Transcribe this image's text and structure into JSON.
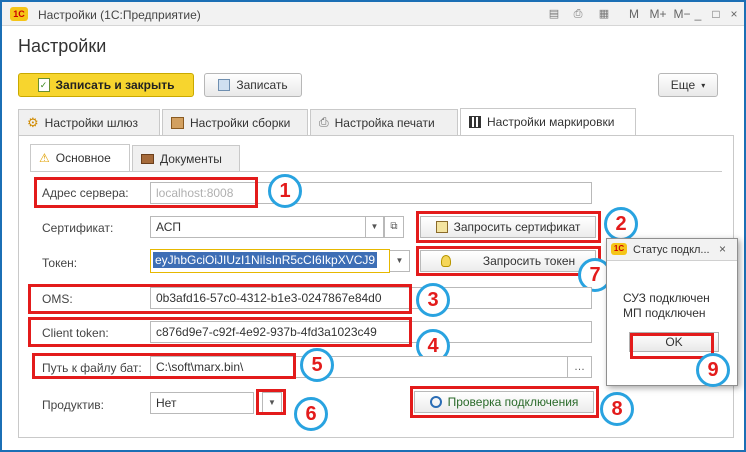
{
  "window": {
    "title": "Настройки  (1С:Предприятие)",
    "logo_text": "1С",
    "controls": [
      "M",
      "M+",
      "M−",
      "_",
      "□",
      "×"
    ]
  },
  "page": {
    "title": "Настройки"
  },
  "toolbar": {
    "save_close_label": "Записать и закрыть",
    "save_label": "Записать",
    "more_label": "Еще"
  },
  "tabs": [
    {
      "label": "Настройки шлюз",
      "icon": "gear-icon"
    },
    {
      "label": "Настройки сборки",
      "icon": "box-icon"
    },
    {
      "label": "Настройка печати",
      "icon": "printer-icon"
    },
    {
      "label": "Настройки маркировки",
      "icon": "qr-icon",
      "active": true
    }
  ],
  "subtabs": [
    {
      "label": "Основное",
      "icon": "warning-icon",
      "active": true
    },
    {
      "label": "Документы",
      "icon": "briefcase-icon"
    }
  ],
  "form": {
    "server_address": {
      "label": "Адрес сервера:",
      "placeholder": "localhost:8008",
      "value": ""
    },
    "certificate": {
      "label": "Сертификат:",
      "value": "АСП"
    },
    "request_certificate_label": "Запросить сертификат",
    "token": {
      "label": "Токен:",
      "value": "eyJhbGciOiJIUzI1NiIsInR5cCI6IkpXVCJ9"
    },
    "request_token_label": "Запросить токен",
    "oms": {
      "label": "OMS:",
      "value": "0b3afd16-57c0-4312-b1e3-0247867e84d0"
    },
    "client_token": {
      "label": "Client token:",
      "value": "c876d9e7-c92f-4e92-937b-4fd3a1023c49"
    },
    "bat_path": {
      "label": "Путь к файлу бат:",
      "value": "C:\\soft\\marx.bin\\"
    },
    "productive": {
      "label": "Продуктив:",
      "value": "Нет"
    },
    "check_connection_label": "Проверка подключения"
  },
  "popup": {
    "title": "Статус подкл...",
    "line1": "СУЗ подключен",
    "line2": "МП подключен",
    "ok_label": "OK"
  },
  "annotations": [
    "1",
    "2",
    "3",
    "4",
    "5",
    "6",
    "7",
    "8",
    "9"
  ],
  "colors": {
    "annotation_red": "#e31b1b",
    "annotation_blue": "#29a3e0",
    "primary_yellow": "#f7d52e",
    "selection_blue": "#3d6eb5"
  }
}
